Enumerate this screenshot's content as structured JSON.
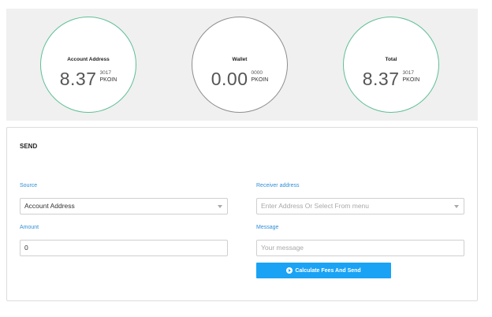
{
  "balances": [
    {
      "label": "Account Address",
      "value": "8.37",
      "fraction": "3017",
      "unit": "PKOIN"
    },
    {
      "label": "Wallet",
      "value": "0.00",
      "fraction": "0000",
      "unit": "PKOIN"
    },
    {
      "label": "Total",
      "value": "8.37",
      "fraction": "3017",
      "unit": "PKOIN"
    }
  ],
  "colors": {
    "ring_active": "#5fbf96",
    "ring_inactive": "#8e8e8e",
    "accent": "#1aa3f5",
    "label": "#2f8fd8"
  },
  "send": {
    "title": "SEND",
    "source": {
      "label": "Source",
      "value": "Account Address"
    },
    "receiver": {
      "label": "Receiver address",
      "placeholder": "Enter Address Or Select From menu"
    },
    "amount": {
      "label": "Amount",
      "value": "0"
    },
    "message": {
      "label": "Message",
      "placeholder": "Your message"
    },
    "submit_label": "Calculate Fees And Send",
    "submit_icon": "arrow-circle-right-icon"
  }
}
